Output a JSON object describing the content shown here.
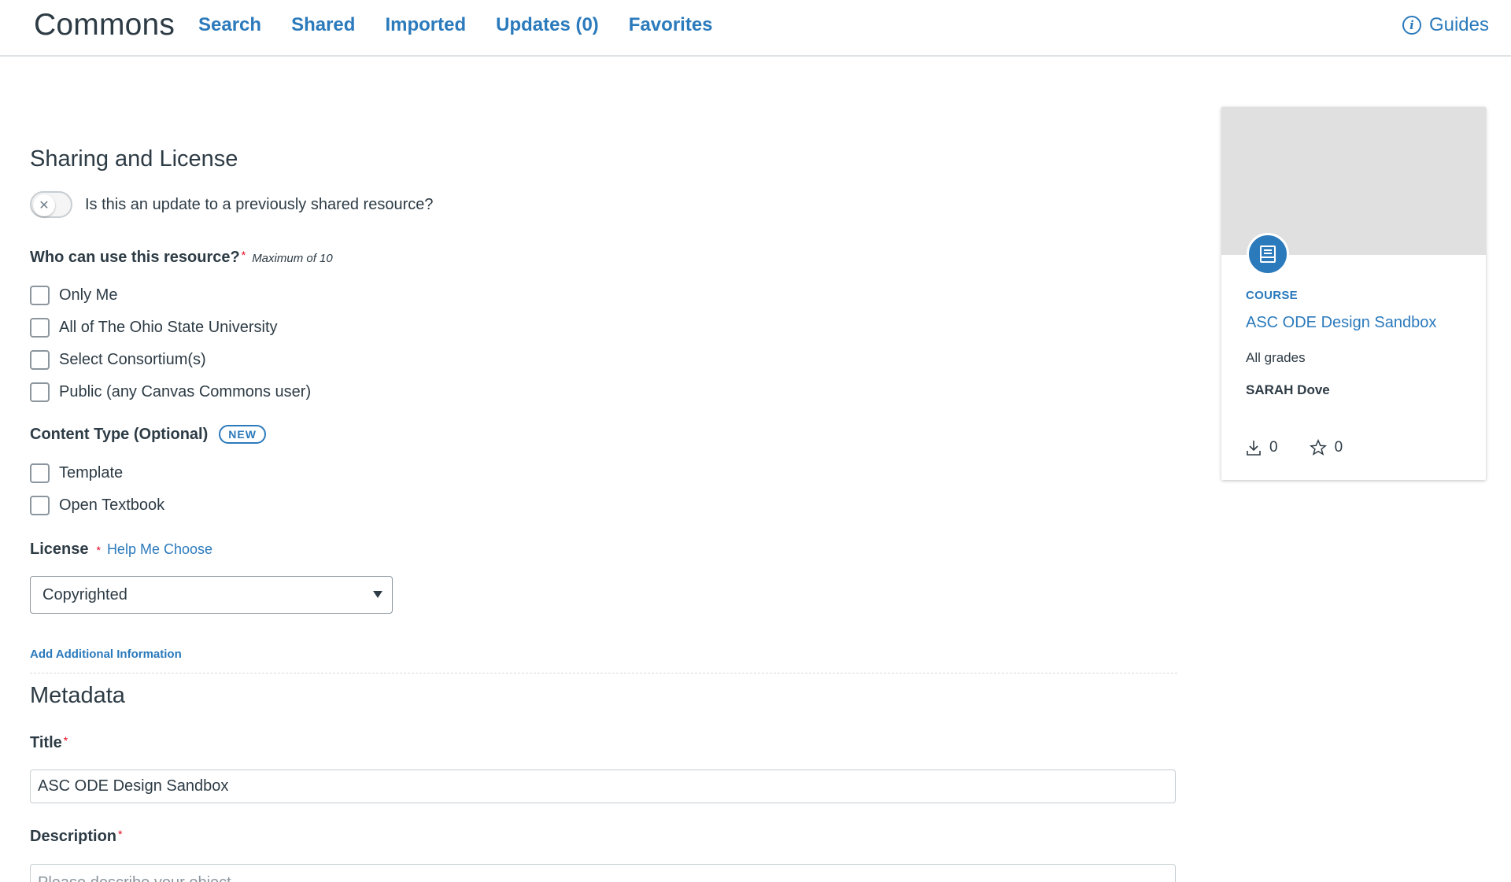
{
  "header": {
    "brand": "Commons",
    "nav": [
      "Search",
      "Shared",
      "Imported",
      "Updates (0)",
      "Favorites"
    ],
    "guides_label": "Guides"
  },
  "sharing": {
    "title": "Sharing and License",
    "update_toggle_label": "Is this an update to a previously shared resource?",
    "who_label": "Who can use this resource?",
    "who_hint": "Maximum of 10",
    "who_options": [
      "Only Me",
      "All of The Ohio State University",
      "Select Consortium(s)",
      "Public (any Canvas Commons user)"
    ],
    "content_type_label": "Content Type (Optional)",
    "new_badge": "NEW",
    "content_type_options": [
      "Template",
      "Open Textbook"
    ],
    "license_label": "License",
    "help_link": "Help Me Choose",
    "license_value": "Copyrighted",
    "add_info_link": "Add Additional Information"
  },
  "metadata": {
    "title": "Metadata",
    "title_label": "Title",
    "title_value": "ASC ODE Design Sandbox",
    "description_label": "Description",
    "description_placeholder": "Please describe your object"
  },
  "card": {
    "type": "COURSE",
    "title": "ASC ODE Design Sandbox",
    "grades": "All grades",
    "author": "SARAH Dove",
    "downloads": "0",
    "favorites": "0"
  },
  "colors": {
    "accent": "#2b7abc",
    "text": "#2d3b45",
    "required": "#e0061f"
  }
}
